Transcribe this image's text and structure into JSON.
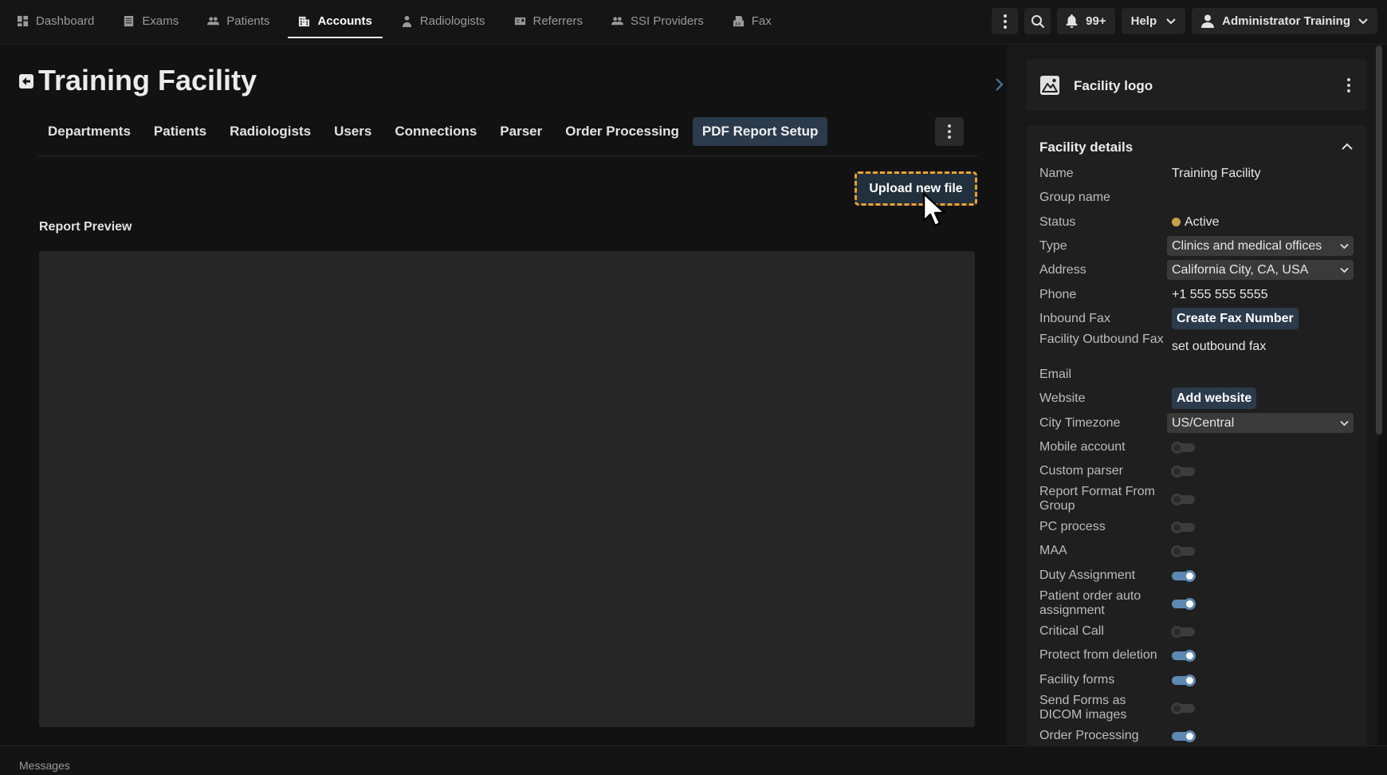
{
  "nav": {
    "items": [
      {
        "label": "Dashboard",
        "icon": "dashboard-icon"
      },
      {
        "label": "Exams",
        "icon": "exams-icon"
      },
      {
        "label": "Patients",
        "icon": "patients-icon"
      },
      {
        "label": "Accounts",
        "icon": "accounts-icon",
        "active": true
      },
      {
        "label": "Radiologists",
        "icon": "radiologist-icon"
      },
      {
        "label": "Referrers",
        "icon": "referrers-icon"
      },
      {
        "label": "SSI Providers",
        "icon": "providers-icon"
      },
      {
        "label": "Fax",
        "icon": "fax-icon"
      }
    ],
    "notifications_count": "99+",
    "help_label": "Help",
    "user_name": "Administrator Training"
  },
  "page": {
    "title": "Training Facility",
    "tabs": [
      "Departments",
      "Patients",
      "Radiologists",
      "Users",
      "Connections",
      "Parser",
      "Order Processing",
      "PDF Report Setup"
    ],
    "active_tab": "PDF Report Setup",
    "upload_label": "Upload new file",
    "preview_label": "Report Preview"
  },
  "facility_logo": {
    "title": "Facility logo"
  },
  "facility_details": {
    "title": "Facility details",
    "name": {
      "label": "Name",
      "value": "Training Facility"
    },
    "group_name": {
      "label": "Group name",
      "value": ""
    },
    "status": {
      "label": "Status",
      "value": "Active",
      "color": "#c8a24a"
    },
    "type": {
      "label": "Type",
      "value": "Clinics and medical offices"
    },
    "address": {
      "label": "Address",
      "value": "California City, CA, USA"
    },
    "phone": {
      "label": "Phone",
      "value": "+1 555 555 5555"
    },
    "inbound_fax": {
      "label": "Inbound Fax",
      "button": "Create Fax Number"
    },
    "outbound_fax": {
      "label": "Facility Outbound Fax",
      "value": "set outbound fax"
    },
    "email": {
      "label": "Email",
      "value": ""
    },
    "website": {
      "label": "Website",
      "button": "Add website"
    },
    "timezone": {
      "label": "City Timezone",
      "value": "US/Central"
    },
    "toggles": [
      {
        "label": "Mobile account",
        "on": false
      },
      {
        "label": "Custom parser",
        "on": false
      },
      {
        "label": "Report Format From Group",
        "on": false
      },
      {
        "label": "PC process",
        "on": false
      },
      {
        "label": "MAA",
        "on": false
      },
      {
        "label": "Duty Assignment",
        "on": true
      },
      {
        "label": "Patient order auto assignment",
        "on": true
      },
      {
        "label": "Critical Call",
        "on": false
      },
      {
        "label": "Protect from deletion",
        "on": true
      },
      {
        "label": "Facility forms",
        "on": true
      },
      {
        "label": "Send Forms as DICOM images",
        "on": false
      },
      {
        "label": "Order Processing",
        "on": true
      }
    ]
  },
  "footer": {
    "messages_label": "Messages"
  },
  "colors": {
    "accent": "#2b3b4c",
    "toggle_on": "#5e89b2",
    "focus_outline": "#f0a02c"
  }
}
